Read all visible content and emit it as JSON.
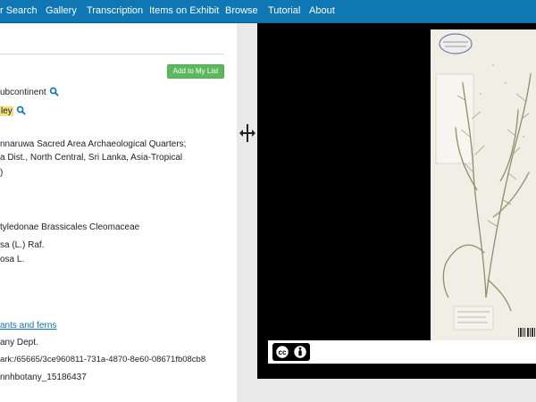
{
  "nav": {
    "items": [
      "r Search",
      "Gallery",
      "Transcription",
      "Items on Exhibit",
      "Browse",
      "Tutorial",
      "About"
    ]
  },
  "record": {
    "add_button": "Add to My List",
    "region": "ubcontinent",
    "region_tag": "ley",
    "locality_line1": "nnaruwa Sacred Area Archaeological Quarters;",
    "locality_line2": "a Dist., North Central, Sri Lanka, Asia-Tropical",
    "locality_line3": ")",
    "taxonomy": "tyledonae Brassicales Cleomaceae",
    "name_line1": "sa (L.) Raf.",
    "name_line2": "osa L.",
    "collection_link": "ants and ferns",
    "department": "any Dept.",
    "ark": "ark:/65665/3ce960811-731a-4870-8e60-08671fb08cb8",
    "catalog_id": "nnhbotany_15186437"
  },
  "icons": {
    "search": "magnifier-icon",
    "handle": "resize-arrows-icon",
    "cc": "creative-commons-icon",
    "attribution": "attribution-icon"
  },
  "colors": {
    "nav": "#0e77b4",
    "button": "#5cb85c",
    "highlight": "#f4e27a",
    "link": "#0e77b4"
  }
}
